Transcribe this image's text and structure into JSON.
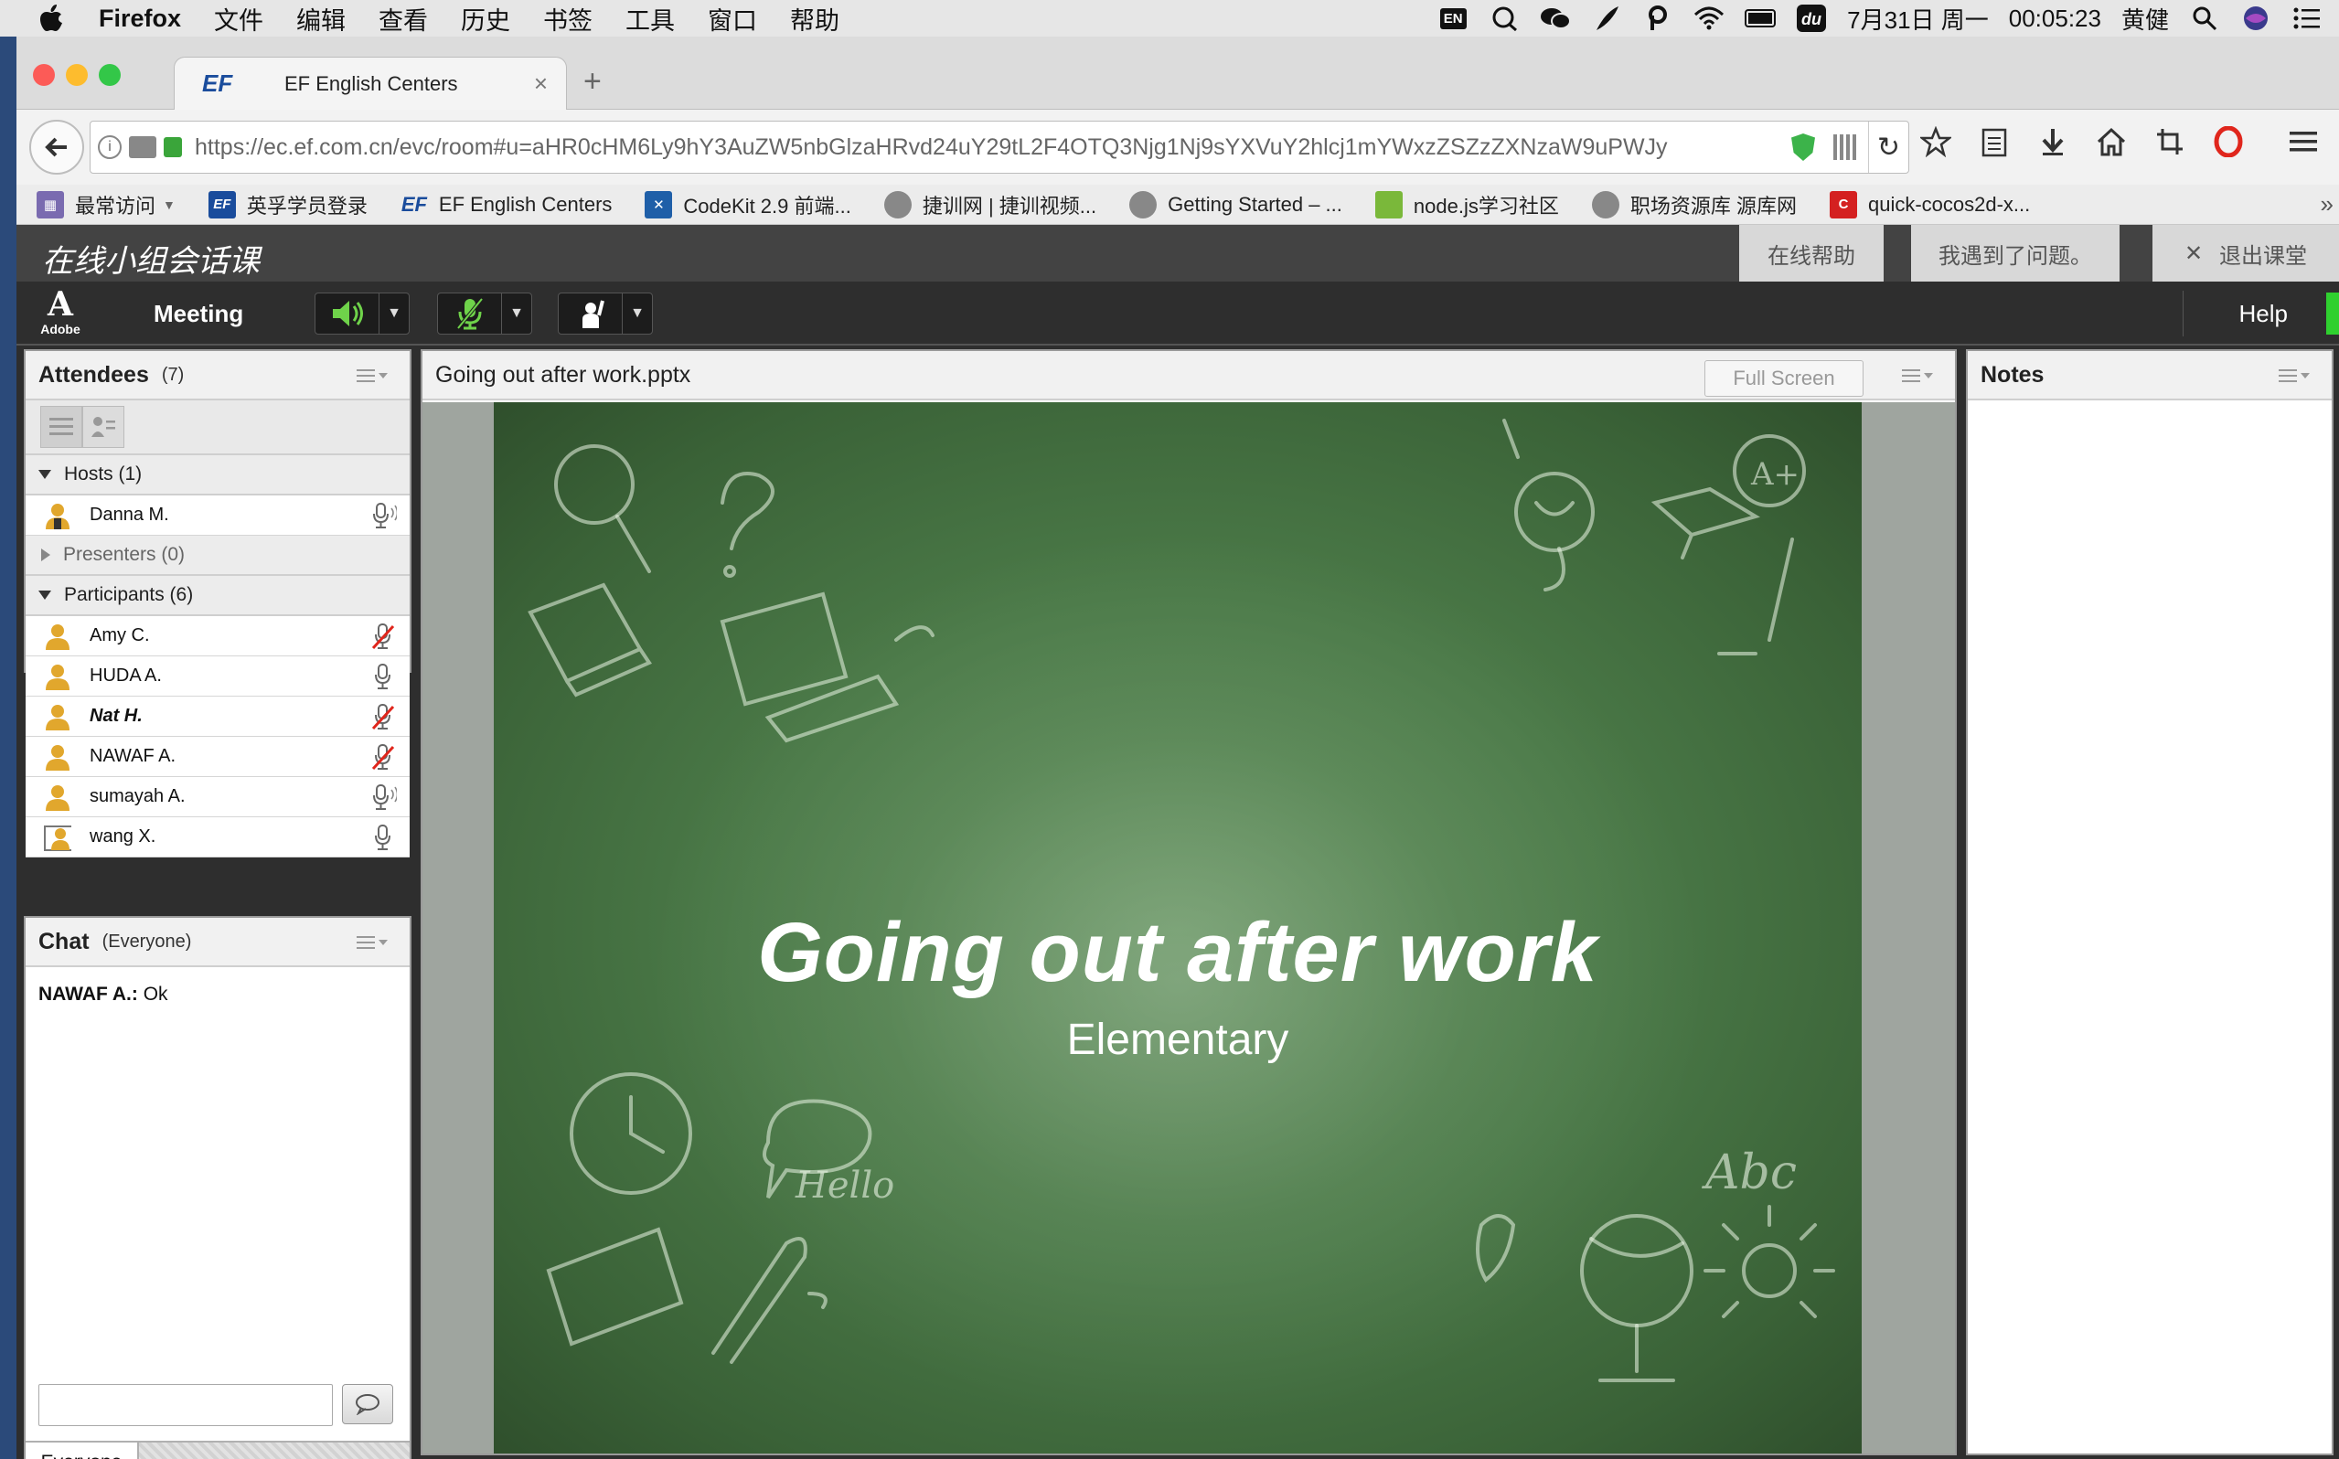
{
  "menubar": {
    "app": "Firefox",
    "items": [
      "文件",
      "编辑",
      "查看",
      "历史",
      "书签",
      "工具",
      "窗口",
      "帮助"
    ],
    "input_badge": "EN",
    "date": "7月31日 周一",
    "time": "00:05:23",
    "user": "黄健"
  },
  "browser": {
    "tab_title": "EF English Centers",
    "tab_logo": "EF",
    "url": "https://ec.ef.com.cn/evc/room#u=aHR0cHM6Ly9hY3AuZW5nbGlzaHRvd24uY29tL2F4OTQ3Njg1Nj9sYXVuY2hlcj1mYWxzZSZzZXNzaW9uPWJy",
    "bookmarks": [
      {
        "label": "最常访问",
        "icon": "frequent-icon",
        "color": "#7a6bb0"
      },
      {
        "label": "英孚学员登录",
        "icon": "ef-icon",
        "color": "#1a4c9c"
      },
      {
        "label": "EF English Centers",
        "icon": "ef-icon",
        "color": "#ececec"
      },
      {
        "label": "CodeKit 2.9 前端...",
        "icon": "codekit-icon",
        "color": "#1f5fa8"
      },
      {
        "label": "捷训网 | 捷训视频...",
        "icon": "globe-icon",
        "color": "#888888"
      },
      {
        "label": "Getting Started – ...",
        "icon": "globe-icon",
        "color": "#888888"
      },
      {
        "label": "node.js学习社区",
        "icon": "node-icon",
        "color": "#7ab83a"
      },
      {
        "label": "职场资源库 源库网",
        "icon": "globe-icon",
        "color": "#888888"
      },
      {
        "label": "quick-cocos2d-x...",
        "icon": "cocos-icon",
        "color": "#d42020"
      }
    ]
  },
  "classroom": {
    "title": "在线小组会话课",
    "help_button": "在线帮助",
    "problem_button": "我遇到了问题。",
    "exit_button": "退出课堂"
  },
  "connect": {
    "brand": "Adobe",
    "meeting_menu": "Meeting",
    "help_menu": "Help"
  },
  "attendees": {
    "title": "Attendees",
    "count": "(7)",
    "hosts_label": "Hosts (1)",
    "hosts": [
      {
        "name": "Danna M.",
        "mic": "speaking"
      }
    ],
    "presenters_label": "Presenters (0)",
    "participants_label": "Participants (6)",
    "participants": [
      {
        "name": "Amy C.",
        "mic": "muted",
        "italic": false
      },
      {
        "name": "HUDA A.",
        "mic": "on",
        "italic": false
      },
      {
        "name": "Nat H.",
        "mic": "muted",
        "italic": true
      },
      {
        "name": "NAWAF A.",
        "mic": "muted",
        "italic": false
      },
      {
        "name": "sumayah A.",
        "mic": "speaking",
        "italic": false
      },
      {
        "name": "wang X.",
        "mic": "on",
        "italic": false
      }
    ]
  },
  "chat": {
    "title": "Chat",
    "scope": "(Everyone)",
    "messages": [
      {
        "sender": "NAWAF A.:",
        "text": " Ok"
      }
    ],
    "tab": "Everyone"
  },
  "share": {
    "filename": "Going out after work.pptx",
    "fullscreen": "Full Screen",
    "slide_title": "Going out after work",
    "slide_subtitle": "Elementary",
    "doodle_hello": "Hello",
    "doodle_abc": "Abc",
    "doodle_aplus": "A+"
  },
  "notes": {
    "title": "Notes"
  }
}
